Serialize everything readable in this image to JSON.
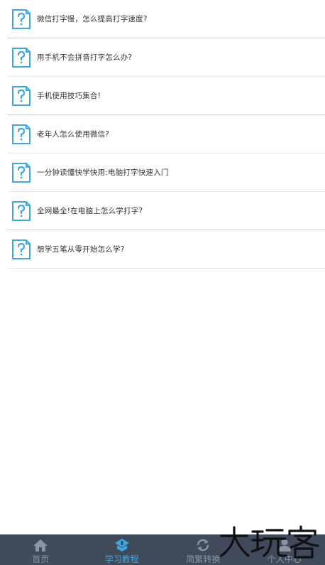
{
  "articles": [
    {
      "title": "微信打字慢，怎么提高打字速度?"
    },
    {
      "title": "用手机不会拼音打字怎么办?"
    },
    {
      "title": "手机使用技巧集合!"
    },
    {
      "title": "老年人怎么使用微信?"
    },
    {
      "title": "一分钟读懂快学快用:电脑打字快速入门"
    },
    {
      "title": "全网最全!在电脑上怎么学打字?"
    },
    {
      "title": "想学五笔从零开始怎么学?"
    }
  ],
  "tabs": [
    {
      "label": "首页",
      "icon": "home-icon"
    },
    {
      "label": "学习教程",
      "icon": "tutorial-icon",
      "active": true
    },
    {
      "label": "简繁转换",
      "icon": "convert-icon"
    },
    {
      "label": "个人中心",
      "icon": "user-icon"
    }
  ],
  "watermark": {
    "text": "大玩客"
  },
  "colors": {
    "accent": "#3ea6e0",
    "tabbar_bg": "#3f4a5a",
    "tab_inactive": "#8b95a3"
  }
}
